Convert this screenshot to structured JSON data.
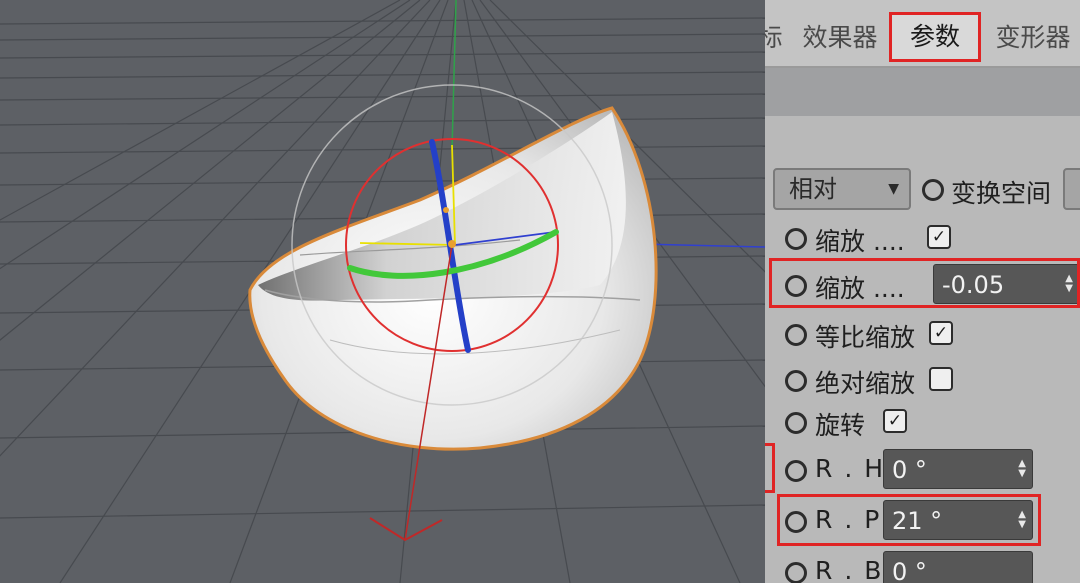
{
  "tabs": [
    {
      "label": "标"
    },
    {
      "label": "效果器"
    },
    {
      "label": "参数"
    },
    {
      "label": "变形器"
    }
  ],
  "params": {
    "space_mode": "相对",
    "transform_space_label": "变换空间",
    "scale_toggle_label": "缩放 ....",
    "scale_value_label": "缩放 ....",
    "scale_value": "-0.05",
    "uniform_scale_label": "等比缩放",
    "absolute_scale_label": "绝对缩放",
    "rotation_label": "旋转",
    "rh_label": "R . H",
    "rh_value": "0 °",
    "rp_label": "R . P",
    "rp_value": "21 °",
    "rb_label": "R . B",
    "rb_value": "0 °",
    "checked_mark": "✓"
  },
  "colors": {
    "highlight": "#e02424",
    "field_bg": "#575757",
    "panel_bg": "#b9b9b9",
    "axis_x": "#e03030",
    "axis_y": "#e8e000",
    "axis_z": "#2040c0",
    "selection": "#d98a3a"
  },
  "icons": {
    "dropdown": "triangle-down-icon",
    "spinner": "updown-arrows-icon",
    "radio": "circle-icon",
    "check": "checkbox-checked-icon"
  }
}
